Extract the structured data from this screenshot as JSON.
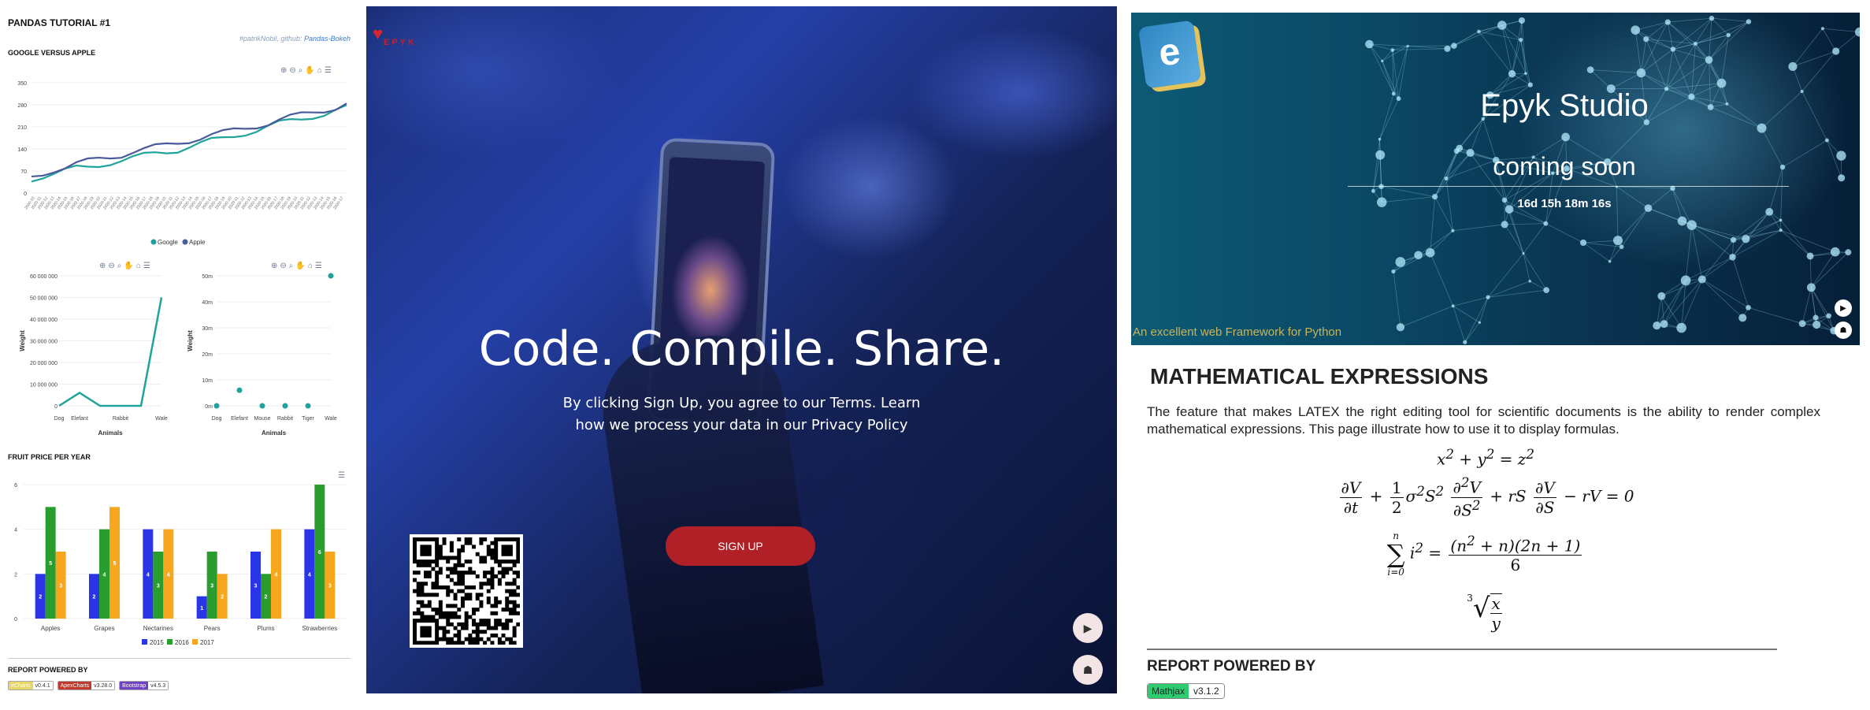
{
  "report": {
    "title": "PANDAS TUTORIAL #1",
    "credit_prefix": "#patrikNobil, github:",
    "credit_link": "Pandas-Bokeh",
    "sections": {
      "google_apple": "GOOGLE VERSUS APPLE",
      "fruit": "FRUIT PRICE PER YEAR",
      "powered": "REPORT POWERED BY"
    },
    "badges": [
      {
        "name": "eCharts",
        "version": "v0.4.1",
        "color": "#e6d66a"
      },
      {
        "name": "ApexCharts",
        "version": "v3.28.0",
        "color": "#c0392b"
      },
      {
        "name": "Bootstrap",
        "version": "v4.5.3",
        "color": "#6f42c1"
      }
    ]
  },
  "chart_data": [
    {
      "type": "line",
      "title": "",
      "ylim": [
        0,
        350
      ],
      "yticks": [
        0,
        70,
        140,
        210,
        280,
        350
      ],
      "legend_position": "bottom",
      "series": [
        {
          "name": "Google",
          "color": "#1fa39a",
          "values": [
            45,
            55,
            62,
            70,
            78,
            82,
            90,
            98,
            104,
            110,
            118,
            126,
            132,
            138,
            148,
            156,
            165,
            172,
            182,
            192,
            200,
            210,
            220,
            228,
            236,
            245,
            252,
            262,
            270
          ]
        },
        {
          "name": "Apple",
          "color": "#4a5b9a",
          "values": [
            50,
            62,
            75,
            82,
            92,
            100,
            108,
            115,
            122,
            132,
            138,
            145,
            152,
            160,
            168,
            176,
            184,
            190,
            198,
            206,
            214,
            222,
            232,
            240,
            248,
            256,
            264,
            272,
            285
          ]
        }
      ]
    },
    {
      "type": "line",
      "title": "",
      "xlabel": "Animals",
      "ylabel": "Weight",
      "categories": [
        "Dog",
        "Elefant",
        "",
        "Rabbit",
        "",
        "Wale"
      ],
      "ylim": [
        0,
        60000000
      ],
      "yticks": [
        "0",
        "10 000 000",
        "20 000 000",
        "30 000 000",
        "40 000 000",
        "50 000 000",
        "60 000 000"
      ],
      "series": [
        {
          "name": "",
          "color": "#1fa39a",
          "values": [
            0,
            6000000,
            0,
            0,
            0,
            50000000
          ]
        }
      ]
    },
    {
      "type": "scatter",
      "title": "",
      "xlabel": "Animals",
      "ylabel": "Weight",
      "categories": [
        "Dog",
        "Elefant",
        "Mouse",
        "Rabbit",
        "Tiger",
        "Wale"
      ],
      "ylim": [
        0,
        50
      ],
      "yticks": [
        "0m",
        "10m",
        "20m",
        "30m",
        "40m",
        "50m"
      ],
      "series": [
        {
          "name": "",
          "color": "#1fa39a",
          "values": [
            0,
            6,
            0,
            0,
            0,
            50
          ]
        }
      ]
    },
    {
      "type": "bar",
      "title": "",
      "categories": [
        "Apples",
        "Grapes",
        "Nectarines",
        "Pears",
        "Plums",
        "Strawberries"
      ],
      "ylim": [
        0,
        6
      ],
      "yticks": [
        0,
        2,
        4,
        6
      ],
      "legend_position": "bottom",
      "series": [
        {
          "name": "2015",
          "color": "#2b35e8",
          "values": [
            2,
            2,
            4,
            1,
            3,
            4
          ]
        },
        {
          "name": "2016",
          "color": "#2a9d2f",
          "values": [
            5,
            4,
            3,
            3,
            2,
            6
          ]
        },
        {
          "name": "2017",
          "color": "#f7a71e",
          "values": [
            3,
            5,
            4,
            2,
            4,
            3
          ]
        }
      ]
    }
  ],
  "hero": {
    "logo": "EPYK",
    "headline": "Code. Compile. Share.",
    "subtext": "By clicking Sign Up, you agree to our Terms. Learn how we process your data in our Privacy Policy",
    "signup": "SIGN UP",
    "play_icon": "play-icon",
    "reader_icon": "reader-icon"
  },
  "studio": {
    "logo_letter": "e",
    "title": "Epyk Studio",
    "subtitle": "coming soon",
    "countdown": "16d 15h 18m 16s",
    "tagline": "An excellent web Framework for Python",
    "math_title": "MATHEMATICAL EXPRESSIONS",
    "math_body": "The feature that makes LATEX the right editing tool for scientific documents is the ability to render complex mathematical expressions. This page illustrate how to use it to display formulas.",
    "report_title": "REPORT POWERED BY",
    "badge_name": "Mathjax",
    "badge_version": "v3.1.2"
  }
}
